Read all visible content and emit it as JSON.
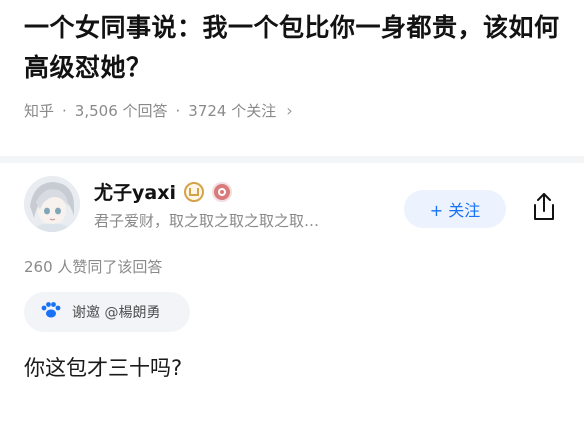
{
  "question": {
    "title": "一个女同事说：我一个包比你一身都贵，该如何高级怼她？",
    "platform": "知乎",
    "answers": "3,506 个回答",
    "followers": "3724 个关注"
  },
  "author": {
    "name": "尤子yaxi",
    "bio": "君子爱财，取之取之取之取之取…",
    "follow_label": "+ 关注"
  },
  "answer": {
    "votes": "260 人赞同了该回答",
    "invite": "谢邀 @楊朗勇",
    "text": "你这包才三十吗?"
  },
  "colors": {
    "accent": "#1772f6",
    "follow_bg": "#ecf2fe",
    "meta_gray": "#8a8a8a",
    "divider": "#f4f5f7"
  },
  "icons": {
    "share": "share-icon",
    "chevron": "chevron-right-icon",
    "badge_gold": "verified-badge-icon",
    "badge_red": "achievement-badge-icon",
    "invite": "paw-icon"
  }
}
